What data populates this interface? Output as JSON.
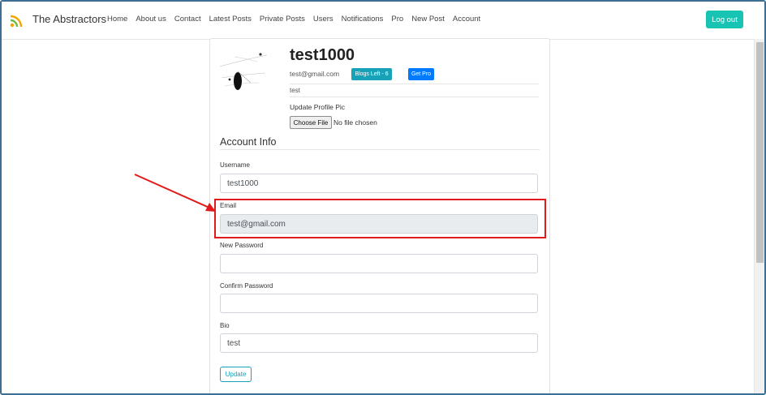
{
  "navbar": {
    "brand": "The Abstractors",
    "items": [
      {
        "label": "Home"
      },
      {
        "label": "About us"
      },
      {
        "label": "Contact"
      },
      {
        "label": "Latest Posts"
      },
      {
        "label": "Private Posts"
      },
      {
        "label": "Users"
      },
      {
        "label": "Notifications"
      },
      {
        "label": "Pro"
      },
      {
        "label": "New Post"
      },
      {
        "label": "Account"
      }
    ],
    "logout_label": "Log out",
    "logo_icon": "rss-icon"
  },
  "profile": {
    "username": "test1000",
    "email": "test@gmail.com",
    "blogs_left_label": "Blogs Left - 6",
    "get_pro_label": "Get Pro",
    "bio": "test",
    "update_pic_label": "Update Profile Pic",
    "choose_file_label": "Choose File",
    "no_file_label": "No file chosen"
  },
  "account_info": {
    "heading": "Account Info",
    "username_label": "Username",
    "username_value": "test1000",
    "email_label": "Email",
    "email_value": "test@gmail.com",
    "new_password_label": "New Password",
    "new_password_value": "",
    "confirm_password_label": "Confirm Password",
    "confirm_password_value": "",
    "bio_label": "Bio",
    "bio_value": "test",
    "update_label": "Update"
  },
  "colors": {
    "accent_teal": "#17c3b2",
    "info": "#17a2b8",
    "primary": "#007bff",
    "highlight": "#e11b1b"
  }
}
